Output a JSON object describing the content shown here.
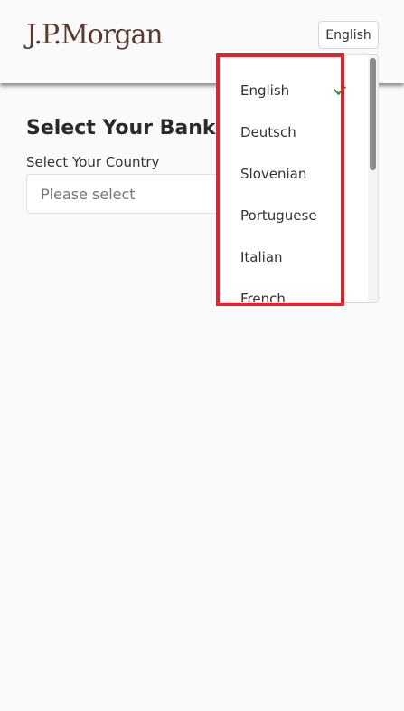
{
  "header": {
    "logo_text": "J.P.Morgan",
    "language_button": "English"
  },
  "main": {
    "title": "Select Your Bank",
    "country_label": "Select Your Country",
    "country_placeholder": "Please select"
  },
  "language_menu": {
    "selected": "English",
    "items": [
      "English",
      "Deutsch",
      "Slovenian",
      "Portuguese",
      "Italian",
      "French"
    ]
  },
  "colors": {
    "logo": "#5a3a2e",
    "highlight": "#e2222c",
    "check": "#3a8a3a"
  }
}
